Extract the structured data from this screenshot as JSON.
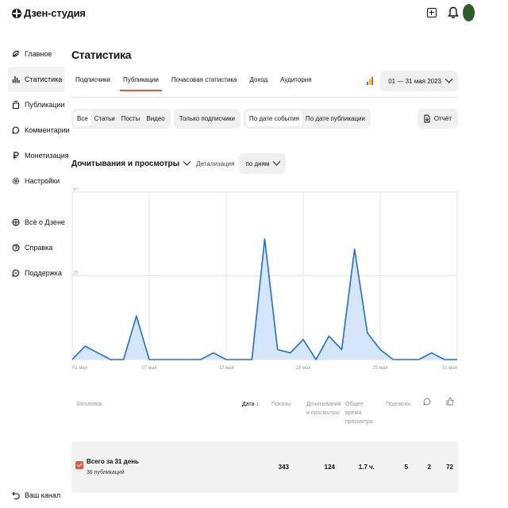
{
  "header": {
    "logo": "Дзен-студия",
    "icons": [
      "plus-icon",
      "bell-icon",
      "avatar"
    ]
  },
  "sidebar": {
    "items": [
      {
        "label": "Главное",
        "icon": "home-icon"
      },
      {
        "label": "Статистика",
        "icon": "stats-icon",
        "active": true
      },
      {
        "label": "Публикации",
        "icon": "publications-icon"
      },
      {
        "label": "Комментарии",
        "icon": "comment-icon"
      },
      {
        "label": "Монетизация",
        "icon": "ruble-icon"
      },
      {
        "label": "Настройки",
        "icon": "gear-icon"
      }
    ],
    "items2": [
      {
        "label": "Всё о Дзене",
        "icon": "dzen-icon"
      },
      {
        "label": "Справка",
        "icon": "help-icon"
      },
      {
        "label": "Поддержка",
        "icon": "support-icon"
      }
    ],
    "bottom": {
      "label": "Ваш канал",
      "icon": "back-icon"
    }
  },
  "main": {
    "title": "Статистика",
    "tabs": [
      {
        "label": "Подписчики"
      },
      {
        "label": "Публикации",
        "active": true
      },
      {
        "label": "Почасовая статистика"
      },
      {
        "label": "Доход"
      },
      {
        "label": "Аудитория"
      }
    ],
    "date_range": "01 — 31 мая 2023",
    "filters": {
      "types": [
        "Все",
        "Статьи",
        "Посты",
        "Видео"
      ],
      "types_selected": "Все",
      "subscribers_only": "Только подписчики",
      "date_mode": [
        "По дате события",
        "По дате публикации"
      ],
      "date_mode_selected": "По дате события"
    },
    "report_button": "Отчёт",
    "metric": "Дочитывания и просмотры",
    "detail_label": "Детализация",
    "detail_value": "по дням"
  },
  "chart_data": {
    "type": "area",
    "x": [
      "01 мая",
      "02 мая",
      "03 мая",
      "04 мая",
      "05 мая",
      "06 мая",
      "07 мая",
      "08 мая",
      "09 мая",
      "10 мая",
      "11 мая",
      "12 мая",
      "13 мая",
      "14 мая",
      "15 мая",
      "16 мая",
      "17 мая",
      "18 мая",
      "19 мая",
      "20 мая",
      "21 мая",
      "22 мая",
      "23 мая",
      "24 мая",
      "25 мая",
      "26 мая",
      "27 мая",
      "28 мая",
      "29 мая",
      "30 мая",
      "31 мая"
    ],
    "x_tick_labels": [
      "01 мая",
      "07 мая",
      "13 мая",
      "19 мая",
      "25 мая",
      "31 мая"
    ],
    "values": [
      0,
      4,
      2,
      0,
      0,
      13,
      0,
      0,
      0,
      0,
      0,
      2,
      0,
      0,
      0,
      36,
      3,
      2,
      6,
      0,
      7,
      3,
      33,
      8,
      3,
      0,
      0,
      0,
      2,
      0,
      0
    ],
    "y_ticks": [
      0,
      25,
      50
    ],
    "ylim": [
      0,
      50
    ],
    "color": "#1f6fc5",
    "fill": "#d6e6fa",
    "grid": true
  },
  "table": {
    "headers": {
      "title": "Заголовок",
      "date": "Дата ↓",
      "shows": "Показы",
      "reads": "Дочитывания и просмотры",
      "time": "Общее время просмотра",
      "subs": "Подписки",
      "comments_icon": "comment-icon",
      "likes_icon": "like-icon"
    },
    "total": {
      "title": "Всего за 31 день",
      "subtitle": "36 публикаций",
      "shows": "343",
      "reads": "124",
      "time": "1.7 ч.",
      "subs": "5",
      "comments": "2",
      "likes": "72"
    }
  },
  "colors": {
    "accent": "#e8573a",
    "line": "#1f6fc5",
    "area": "#d6e6fa",
    "chip_bg": "#f0f0f0"
  }
}
